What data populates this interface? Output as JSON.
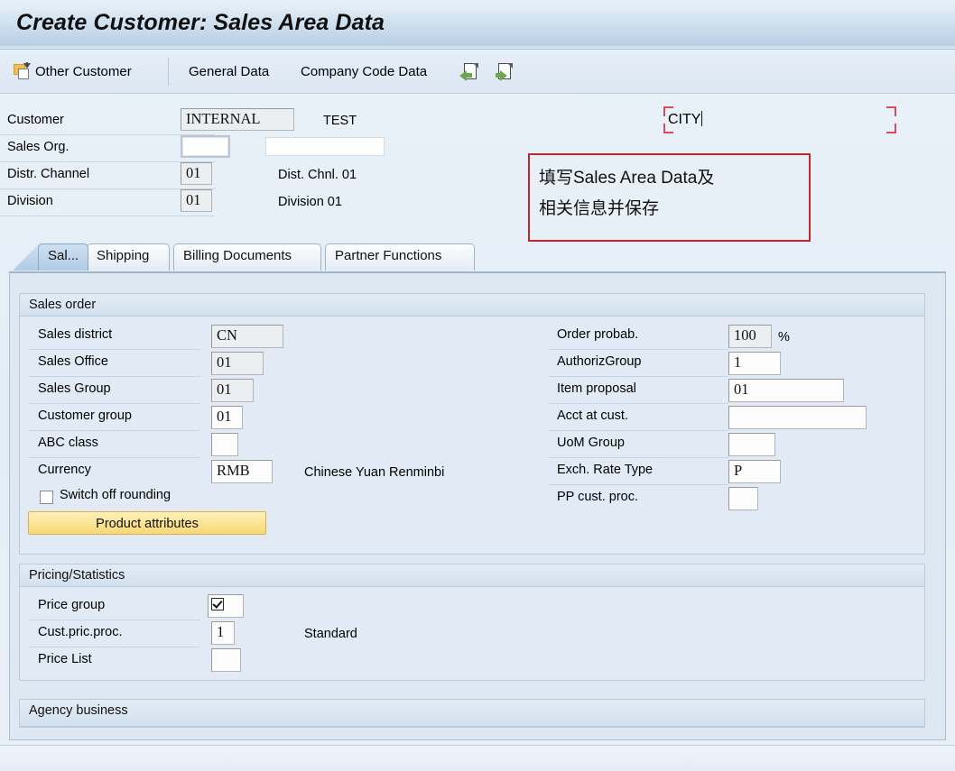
{
  "window": {
    "title": "Create Customer: Sales Area Data"
  },
  "toolbar": {
    "other_customer": "Other Customer",
    "general_data": "General Data",
    "company_code_data": "Company Code Data",
    "icons": {
      "other_customer_icon": "other-customer-icon",
      "back_doc_icon": "document-back-icon",
      "forward_doc_icon": "document-forward-icon"
    }
  },
  "header": {
    "rows": [
      {
        "label": "Customer",
        "value": "INTERNAL",
        "desc": "TEST"
      },
      {
        "label": "Sales Org.",
        "value": "",
        "desc": ""
      },
      {
        "label": "Distr. Channel",
        "value": "01",
        "desc": "Dist. Chnl. 01"
      },
      {
        "label": "Division",
        "value": "01",
        "desc": "Division 01"
      }
    ],
    "city_field": {
      "value": "CITY",
      "focused": true
    }
  },
  "annotation": {
    "line1": "填写Sales Area Data及",
    "line2": "相关信息并保存",
    "border_color": "#c0272d"
  },
  "tabs": [
    {
      "label": "Sal...",
      "active": true
    },
    {
      "label": "Shipping",
      "active": false
    },
    {
      "label": "Billing Documents",
      "active": false
    },
    {
      "label": "Partner Functions",
      "active": false
    }
  ],
  "sections": {
    "sales_order": {
      "title": "Sales order",
      "left_fields": [
        {
          "label": "Sales district",
          "value": "CN"
        },
        {
          "label": "Sales Office",
          "value": "01"
        },
        {
          "label": "Sales Group",
          "value": "01"
        },
        {
          "label": "Customer group",
          "value": "01"
        },
        {
          "label": "ABC class",
          "value": ""
        },
        {
          "label": "Currency",
          "value": "RMB",
          "desc": "Chinese Yuan Renminbi"
        }
      ],
      "switch_off_rounding": {
        "label": "Switch off rounding",
        "checked": false
      },
      "product_attributes_button": "Product attributes",
      "right_fields": [
        {
          "label": "Order probab.",
          "value": "100",
          "suffix": "%"
        },
        {
          "label": "AuthorizGroup",
          "value": "1"
        },
        {
          "label": "Item proposal",
          "value": "01"
        },
        {
          "label": "Acct at cust.",
          "value": ""
        },
        {
          "label": "UoM Group",
          "value": ""
        },
        {
          "label": "Exch. Rate Type",
          "value": "P"
        },
        {
          "label": "PP cust. proc.",
          "value": ""
        }
      ]
    },
    "pricing_statistics": {
      "title": "Pricing/Statistics",
      "fields": [
        {
          "label": "Price group",
          "value": "",
          "icon": "checkbox-checked-icon"
        },
        {
          "label": "Cust.pric.proc.",
          "value": "1",
          "desc": "Standard"
        },
        {
          "label": "Price List",
          "value": ""
        }
      ]
    },
    "agency_business": {
      "title": "Agency business"
    }
  },
  "colors": {
    "title_bar": "#b9d0e5",
    "accent_button": "#fbe596",
    "annotation_red": "#c0272d",
    "focus_red": "#d94b5a",
    "panel_bg": "#dde8f3"
  }
}
